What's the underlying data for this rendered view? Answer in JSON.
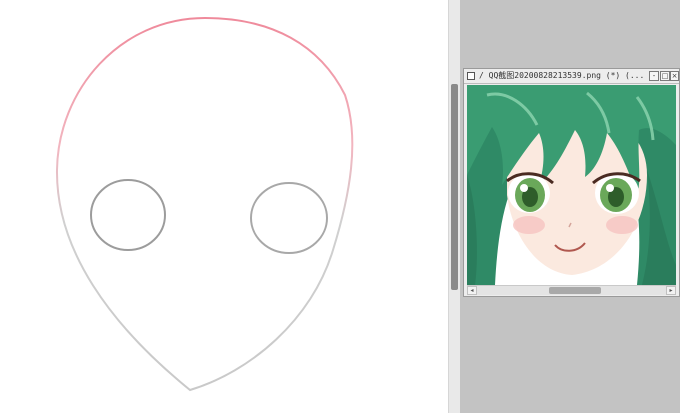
{
  "canvas": {
    "sketch_name": "face-outline-sketch"
  },
  "reference_window": {
    "title": "/ QQ截图20200828213539.png (*) (...",
    "buttons": {
      "minimize": "-",
      "maximize": "□",
      "close": "×"
    },
    "scroll_left": "◂",
    "scroll_right": "▸",
    "image_alt": "green-haired anime girl reference"
  },
  "colors": {
    "panel_bg": "#c3c3c3",
    "sketch_top": "#f0a0ad",
    "sketch_bottom": "#c8c8c8",
    "hair": "#2e8b68",
    "eye": "#6aa85a"
  }
}
